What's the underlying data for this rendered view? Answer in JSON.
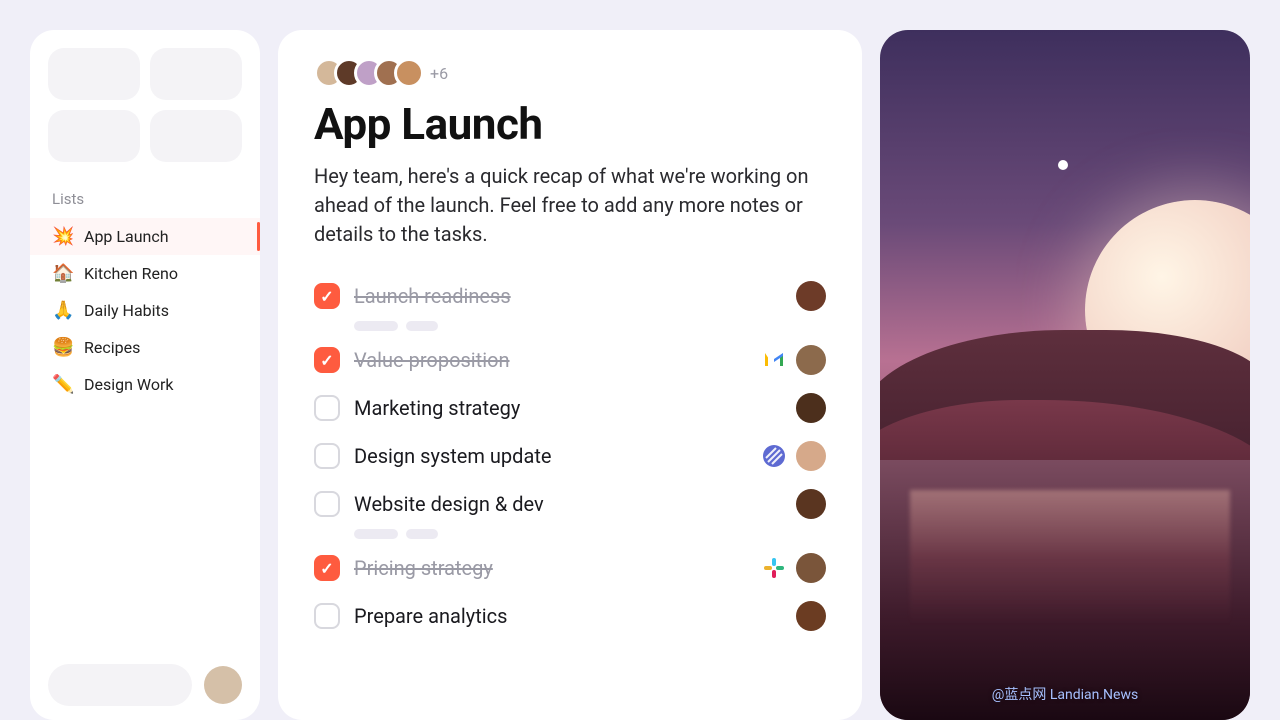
{
  "sidebar": {
    "section_label": "Lists",
    "items": [
      {
        "emoji": "💥",
        "label": "App Launch",
        "active": true
      },
      {
        "emoji": "🏠",
        "label": "Kitchen Reno",
        "active": false
      },
      {
        "emoji": "🙏",
        "label": "Daily Habits",
        "active": false
      },
      {
        "emoji": "🍔",
        "label": "Recipes",
        "active": false
      },
      {
        "emoji": "✏️",
        "label": "Design Work",
        "active": false
      }
    ]
  },
  "main": {
    "avatars": {
      "extra_label": "+6",
      "colors": [
        "#d4b89a",
        "#5e3a28",
        "#bfa0c7",
        "#a07050",
        "#c89060"
      ]
    },
    "title": "App Launch",
    "intro": "Hey team, here's a quick recap of what we're working on ahead of the launch. Feel free to add any more notes or details to the tasks.",
    "tasks": [
      {
        "label": "Launch readiness",
        "done": true,
        "skeleton": true,
        "integration": null,
        "assignee_color": "#6d3b28"
      },
      {
        "label": "Value proposition",
        "done": true,
        "skeleton": false,
        "integration": "gmail",
        "assignee_color": "#8c6a4c"
      },
      {
        "label": "Marketing strategy",
        "done": false,
        "skeleton": false,
        "integration": null,
        "assignee_color": "#4c2f1c"
      },
      {
        "label": "Design system update",
        "done": false,
        "skeleton": false,
        "integration": "linear",
        "assignee_color": "#d6a98a"
      },
      {
        "label": "Website design & dev",
        "done": false,
        "skeleton": true,
        "integration": null,
        "assignee_color": "#5a3520"
      },
      {
        "label": "Pricing strategy",
        "done": true,
        "skeleton": false,
        "integration": "slack",
        "assignee_color": "#7a553a"
      },
      {
        "label": "Prepare analytics",
        "done": false,
        "skeleton": false,
        "integration": null,
        "assignee_color": "#6b3c22"
      }
    ]
  },
  "hero": {
    "credit": "@蓝点网 Landian.News"
  }
}
